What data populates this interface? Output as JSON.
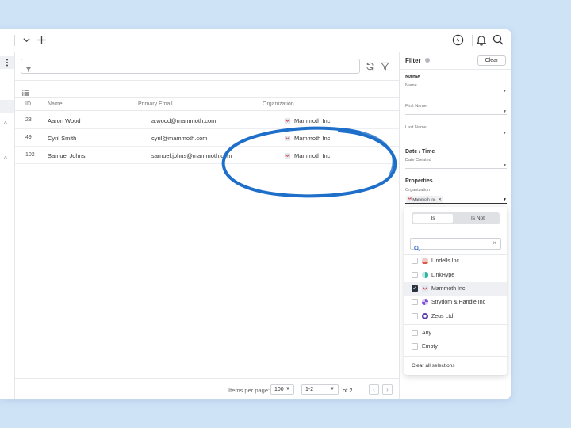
{
  "table": {
    "columns": {
      "id": "ID",
      "name": "Name",
      "email": "Primary Email",
      "org": "Organization"
    },
    "rows": [
      {
        "id": "23",
        "name": "Aaron Wood",
        "email": "a.wood@mammoth.com",
        "org": "Mammoth Inc"
      },
      {
        "id": "49",
        "name": "Cyril Smith",
        "email": "cyril@mammoth.com",
        "org": "Mammoth Inc"
      },
      {
        "id": "102",
        "name": "Samuel Johns",
        "email": "samuel.johns@mammoth.com",
        "org": "Mammoth Inc"
      }
    ]
  },
  "search": {
    "placeholder": ""
  },
  "pager": {
    "items_per_page_label": "Items per page:",
    "items_per_page_value": "100",
    "range_value": "1-2",
    "of_label": "of 2"
  },
  "filter": {
    "title": "Filter",
    "clear_label": "Clear",
    "sections": {
      "name": "Name",
      "date": "Date / Time",
      "properties": "Properties"
    },
    "fields": {
      "name": "Name",
      "first_name": "First Name",
      "last_name": "Last Name",
      "date_created": "Date Created",
      "organization": "Organization"
    },
    "chip_label": "Mammoth Inc",
    "toggle": {
      "is": "Is",
      "is_not": "Is Not"
    },
    "dropdown_search_placeholder": "",
    "options": [
      {
        "label": "Lindells Inc",
        "checked": false
      },
      {
        "label": "LinkHype",
        "checked": false
      },
      {
        "label": "Mammoth Inc",
        "checked": true
      },
      {
        "label": "Strydom & Handle Inc",
        "checked": false
      },
      {
        "label": "Zeus Ltd",
        "checked": false
      }
    ],
    "extra_options": {
      "any": "Any",
      "empty": "Empty"
    },
    "clear_all": "Clear all selections"
  },
  "colors": {
    "background": "#cfe3f7",
    "highlight_stroke": "#1e6fc9",
    "checkbox_checked": "#2a3240"
  }
}
